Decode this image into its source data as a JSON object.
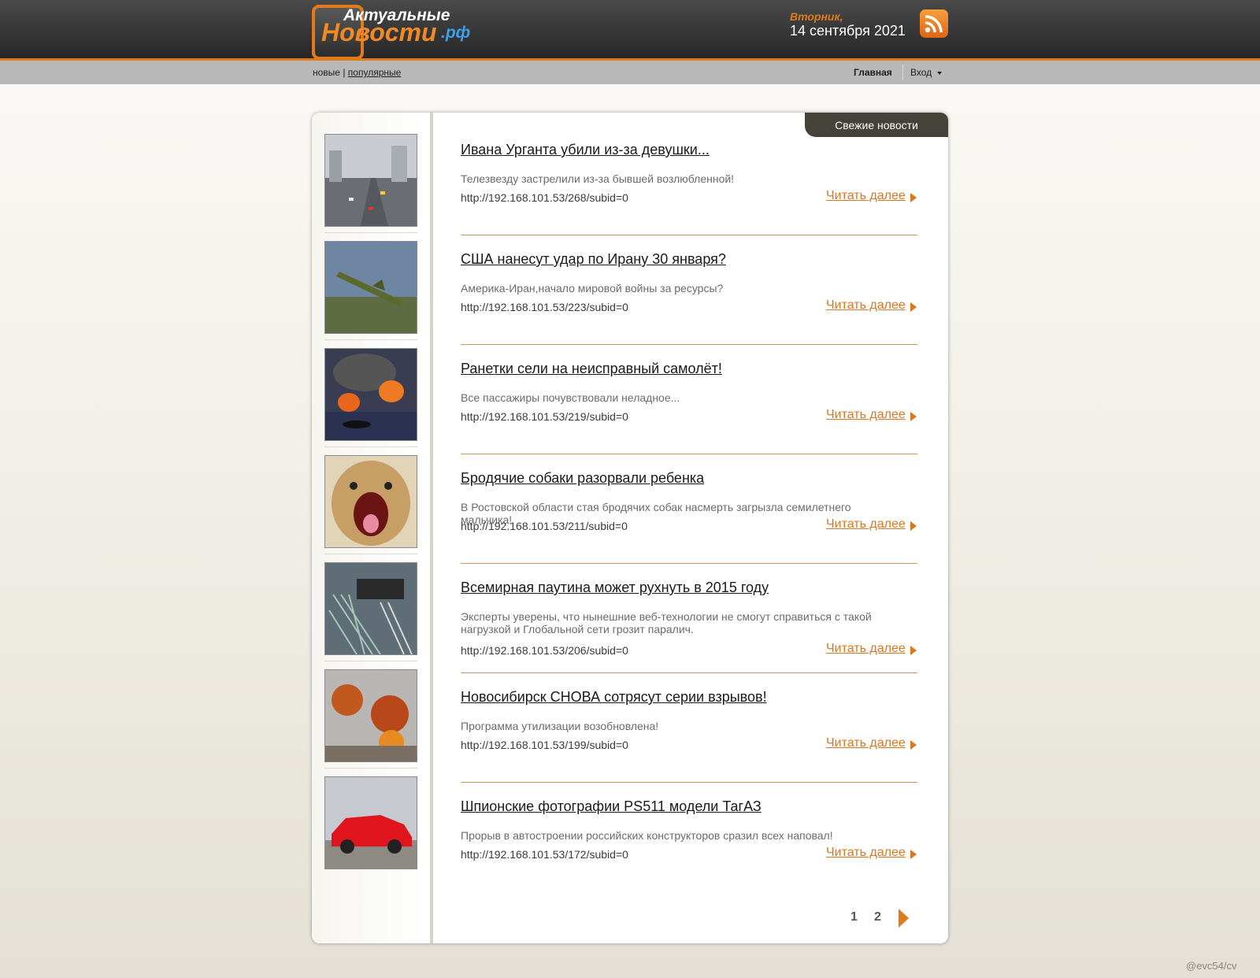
{
  "header": {
    "logo_top": "Актуальные",
    "logo_main": "Новости",
    "logo_suffix": ".рф",
    "weekday": "Вторник,",
    "date": "14 сентября 2021",
    "rss_icon": "rss-icon"
  },
  "nav": {
    "new_label": "новые",
    "separator": "|",
    "popular_label": "популярные",
    "home_label": "Главная",
    "login_label": "Вход",
    "login_icon": "caret-down-icon"
  },
  "panel": {
    "tab_label": "Свежие новости"
  },
  "news": [
    {
      "title": "Ивана Урганта убили из-за девушки...",
      "desc": "Телезвезду застрелили из-за бывшей возлюбленной!",
      "url": "http://192.168.101.53/268/subid=0",
      "more": "Читать далее"
    },
    {
      "title": "США нанесут удар по Ирану 30 января?",
      "desc": "Америка-Иран,начало мировой войны за ресурсы?",
      "url": "http://192.168.101.53/223/subid=0",
      "more": "Читать далее"
    },
    {
      "title": "Ранетки сели на неисправный самолёт!",
      "desc": "Все пассажиры почувствовали неладное...",
      "url": "http://192.168.101.53/219/subid=0",
      "more": "Читать далее"
    },
    {
      "title": "Бродячие собаки разорвали ребенка",
      "desc": "В Ростовской области стая бродячих собак насмерть загрызла семилетнего мальчика!",
      "url": "http://192.168.101.53/211/subid=0",
      "more": "Читать далее"
    },
    {
      "title": "Всемирная паутина может рухнуть в 2015 году",
      "desc": "Эксперты уверены, что нынешние веб-технологии не смогут справиться с такой нагрузкой и Глобальной сети грозит паралич.",
      "url": "http://192.168.101.53/206/subid=0",
      "more": "Читать далее"
    },
    {
      "title": "Новосибирск СНОВА сотрясут серии взрывов!",
      "desc": "Программа утилизации возобновлена!",
      "url": "http://192.168.101.53/199/subid=0",
      "more": "Читать далее"
    },
    {
      "title": "Шпионские фотографии PS511 модели ТагАЗ",
      "desc": "Прорыв в автостроении российских конструкторов сразил всех наповал!",
      "url": "http://192.168.101.53/172/subid=0",
      "more": "Читать далее"
    }
  ],
  "pagination": {
    "pages": [
      "1",
      "2"
    ],
    "next_icon": "next-arrow-icon"
  },
  "watermark": "@evc54/cv"
}
